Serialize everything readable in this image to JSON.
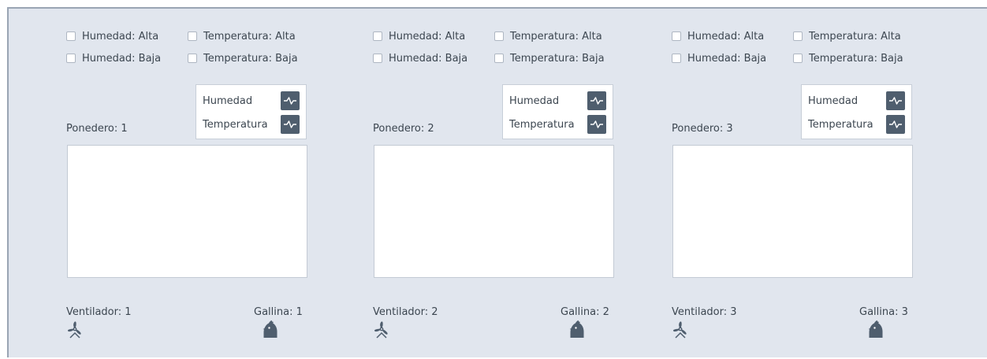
{
  "panels": [
    {
      "checkboxes": {
        "humedad_alta": "Humedad: Alta",
        "temperatura_alta": "Temperatura: Alta",
        "humedad_baja": "Humedad: Baja",
        "temperatura_baja": "Temperatura: Baja"
      },
      "legend": {
        "humedad": "Humedad",
        "temperatura": "Temperatura"
      },
      "ponedero": "Ponedero: 1",
      "ventilador": "Ventilador: 1",
      "gallina": "Gallina: 1"
    },
    {
      "checkboxes": {
        "humedad_alta": "Humedad: Alta",
        "temperatura_alta": "Temperatura: Alta",
        "humedad_baja": "Humedad: Baja",
        "temperatura_baja": "Temperatura: Baja"
      },
      "legend": {
        "humedad": "Humedad",
        "temperatura": "Temperatura"
      },
      "ponedero": "Ponedero: 2",
      "ventilador": "Ventilador: 2",
      "gallina": "Gallina: 2"
    },
    {
      "checkboxes": {
        "humedad_alta": "Humedad: Alta",
        "temperatura_alta": "Temperatura: Alta",
        "humedad_baja": "Humedad: Baja",
        "temperatura_baja": "Temperatura: Baja"
      },
      "legend": {
        "humedad": "Humedad",
        "temperatura": "Temperatura"
      },
      "ponedero": "Ponedero: 3",
      "ventilador": "Ventilador: 3",
      "gallina": "Gallina: 3"
    }
  ],
  "icons": {
    "pulse": "pulse-chart-icon",
    "fan": "fan-icon",
    "hen": "hen-icon"
  },
  "colors": {
    "background": "#e1e6ee",
    "icon_button": "#4f5e6e",
    "text": "#3c4650"
  }
}
